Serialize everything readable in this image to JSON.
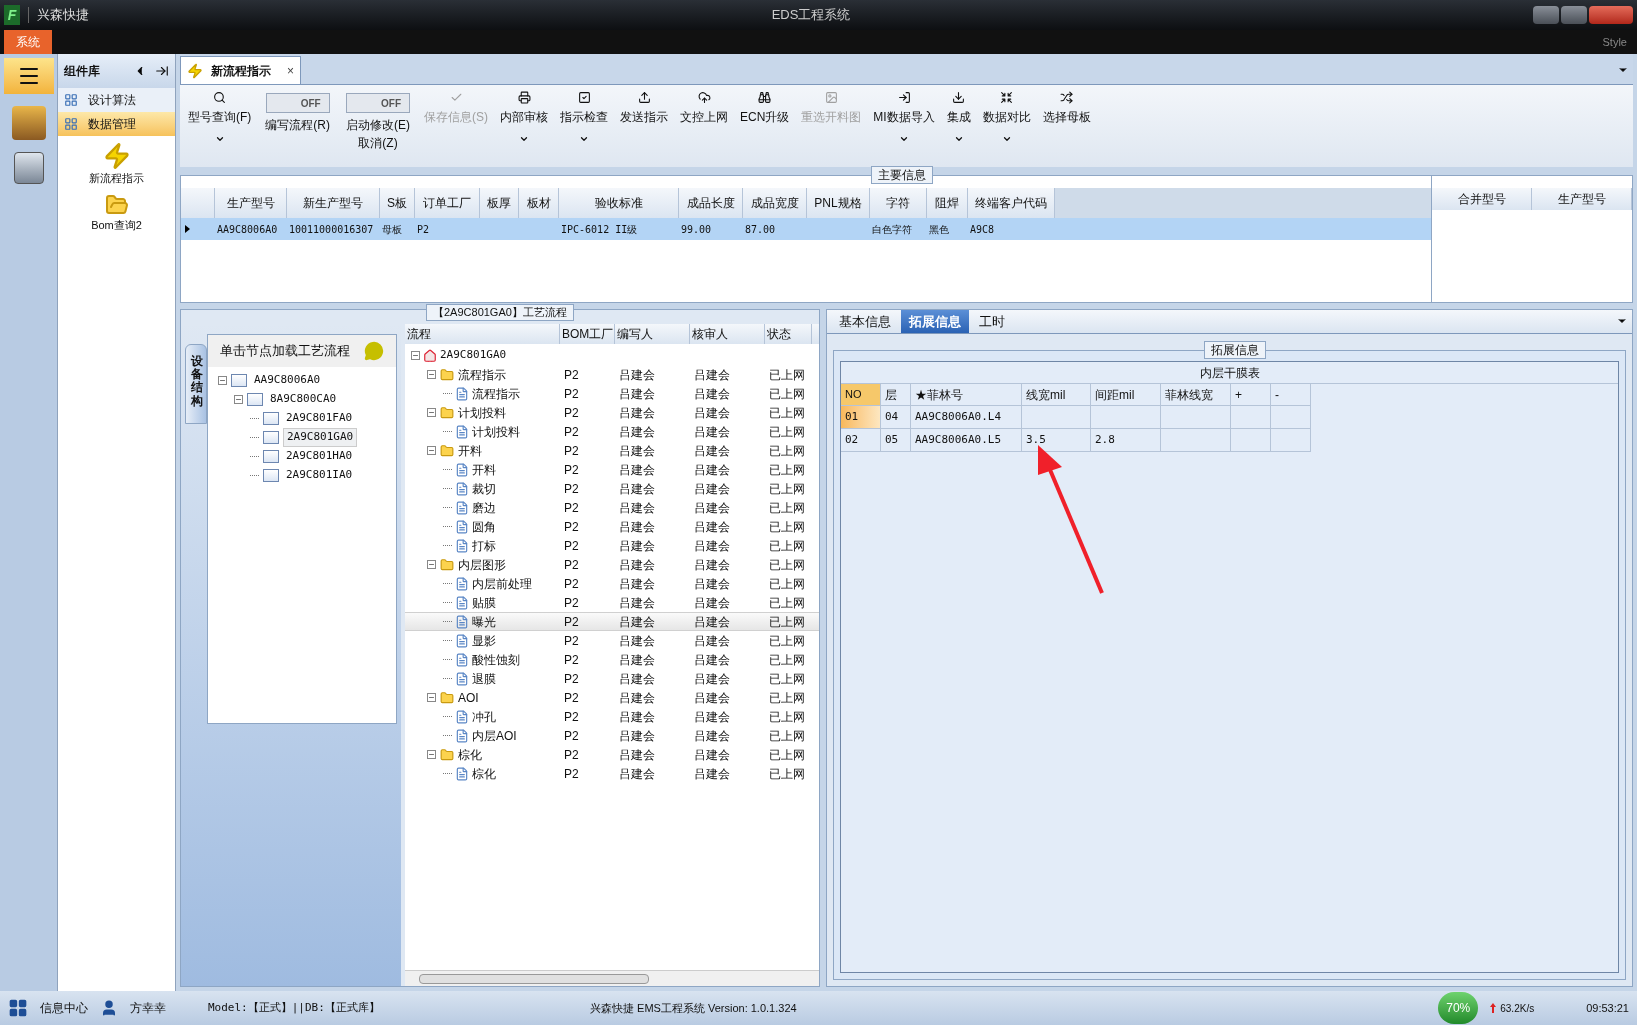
{
  "window": {
    "logo": "F",
    "app_name": "兴森快捷",
    "title": "EDS工程系统",
    "ribbon_tab": "系统",
    "style_menu": "Style"
  },
  "component_panel": {
    "title": "组件库",
    "items": [
      {
        "label": "设计算法",
        "selected": false
      },
      {
        "label": "数据管理",
        "selected": true
      }
    ],
    "tools": [
      "新流程指示",
      "Bom查询2"
    ]
  },
  "document_tab": {
    "label": "新流程指示",
    "close": "×"
  },
  "toolbar": [
    {
      "kind": "button",
      "label": "型号查询(F)",
      "disabled": false,
      "dropdown": true
    },
    {
      "kind": "toggle",
      "label": "编写流程(R)",
      "state": "OFF",
      "on": false
    },
    {
      "kind": "toggle",
      "label": "启动修改(E)",
      "state": "OFF",
      "on": false,
      "sublabel": "取消(Z)"
    },
    {
      "kind": "button",
      "label": "保存信息(S)",
      "disabled": true,
      "dropdown": false
    },
    {
      "kind": "button",
      "label": "内部审核",
      "disabled": false,
      "dropdown": true
    },
    {
      "kind": "button",
      "label": "指示检查",
      "disabled": false,
      "dropdown": true
    },
    {
      "kind": "button",
      "label": "发送指示",
      "disabled": false,
      "dropdown": false
    },
    {
      "kind": "button",
      "label": "文控上网",
      "disabled": false,
      "dropdown": false
    },
    {
      "kind": "button",
      "label": "ECN升级",
      "disabled": false,
      "dropdown": false
    },
    {
      "kind": "button",
      "label": "重选开料图",
      "disabled": true,
      "dropdown": false
    },
    {
      "kind": "button",
      "label": "MI数据导入",
      "disabled": false,
      "dropdown": true
    },
    {
      "kind": "button",
      "label": "集成",
      "disabled": false,
      "dropdown": true
    },
    {
      "kind": "button",
      "label": "数据对比",
      "disabled": false,
      "dropdown": true
    },
    {
      "kind": "button",
      "label": "选择母板",
      "disabled": false,
      "dropdown": false
    }
  ],
  "main_info": {
    "title": "主要信息",
    "columns": [
      "生产型号",
      "新生产型号",
      "S板",
      "订单工厂",
      "板厚",
      "板材",
      "验收标准",
      "成品长度",
      "成品宽度",
      "PNL规格",
      "字符",
      "阻焊",
      "终端客户代码"
    ],
    "rows": [
      {
        "selected": true,
        "cells": [
          "AA9C8006A0",
          "10011000016307",
          "母板",
          "P2",
          "",
          "",
          "IPC-6012 II级",
          "99.00",
          "87.00",
          "",
          "白色字符",
          "黑色",
          "A9C8"
        ]
      }
    ],
    "side_columns": [
      "合并型号",
      "生产型号"
    ]
  },
  "structure_panel": {
    "side_tab": "设备结构",
    "header": "单击节点加载工艺流程",
    "tree": [
      {
        "label": "AA9C8006A0",
        "expanded": true,
        "selected": false,
        "children": [
          {
            "label": "8A9C800CA0",
            "expanded": true,
            "selected": false,
            "children": [
              {
                "label": "2A9C801FA0",
                "selected": false
              },
              {
                "label": "2A9C801GA0",
                "selected": true
              },
              {
                "label": "2A9C801HA0",
                "selected": false
              },
              {
                "label": "2A9C801IA0",
                "selected": false
              }
            ]
          }
        ]
      }
    ]
  },
  "process_panel": {
    "title": "【2A9C801GA0】工艺流程",
    "columns": [
      "流程",
      "BOM工厂",
      "编写人",
      "核审人",
      "状态"
    ],
    "tree": [
      {
        "kind": "root",
        "label": "2A9C801GA0",
        "expanded": true,
        "selected": false,
        "children": [
          {
            "kind": "folder",
            "label": "流程指示",
            "expanded": true,
            "selected": false,
            "cells": [
              "P2",
              "吕建会",
              "吕建会",
              "已上网"
            ],
            "children": [
              {
                "kind": "doc",
                "label": "流程指示",
                "selected": false,
                "cells": [
                  "P2",
                  "吕建会",
                  "吕建会",
                  "已上网"
                ]
              }
            ]
          },
          {
            "kind": "folder",
            "label": "计划投料",
            "expanded": true,
            "selected": false,
            "cells": [
              "P2",
              "吕建会",
              "吕建会",
              "已上网"
            ],
            "children": [
              {
                "kind": "doc",
                "label": "计划投料",
                "selected": false,
                "cells": [
                  "P2",
                  "吕建会",
                  "吕建会",
                  "已上网"
                ]
              }
            ]
          },
          {
            "kind": "folder",
            "label": "开料",
            "expanded": true,
            "selected": false,
            "cells": [
              "P2",
              "吕建会",
              "吕建会",
              "已上网"
            ],
            "children": [
              {
                "kind": "doc",
                "label": "开料",
                "selected": false,
                "cells": [
                  "P2",
                  "吕建会",
                  "吕建会",
                  "已上网"
                ]
              },
              {
                "kind": "doc",
                "label": "裁切",
                "selected": false,
                "cells": [
                  "P2",
                  "吕建会",
                  "吕建会",
                  "已上网"
                ]
              },
              {
                "kind": "doc",
                "label": "磨边",
                "selected": false,
                "cells": [
                  "P2",
                  "吕建会",
                  "吕建会",
                  "已上网"
                ]
              },
              {
                "kind": "doc",
                "label": "圆角",
                "selected": false,
                "cells": [
                  "P2",
                  "吕建会",
                  "吕建会",
                  "已上网"
                ]
              },
              {
                "kind": "doc",
                "label": "打标",
                "selected": false,
                "cells": [
                  "P2",
                  "吕建会",
                  "吕建会",
                  "已上网"
                ]
              }
            ]
          },
          {
            "kind": "folder",
            "label": "内层图形",
            "expanded": true,
            "selected": false,
            "cells": [
              "P2",
              "吕建会",
              "吕建会",
              "已上网"
            ],
            "children": [
              {
                "kind": "doc",
                "label": "内层前处理",
                "selected": false,
                "cells": [
                  "P2",
                  "吕建会",
                  "吕建会",
                  "已上网"
                ]
              },
              {
                "kind": "doc",
                "label": "贴膜",
                "selected": false,
                "cells": [
                  "P2",
                  "吕建会",
                  "吕建会",
                  "已上网"
                ]
              },
              {
                "kind": "doc",
                "label": "曝光",
                "selected": true,
                "cells": [
                  "P2",
                  "吕建会",
                  "吕建会",
                  "已上网"
                ]
              },
              {
                "kind": "doc",
                "label": "显影",
                "selected": false,
                "cells": [
                  "P2",
                  "吕建会",
                  "吕建会",
                  "已上网"
                ]
              },
              {
                "kind": "doc",
                "label": "酸性蚀刻",
                "selected": false,
                "cells": [
                  "P2",
                  "吕建会",
                  "吕建会",
                  "已上网"
                ]
              },
              {
                "kind": "doc",
                "label": "退膜",
                "selected": false,
                "cells": [
                  "P2",
                  "吕建会",
                  "吕建会",
                  "已上网"
                ]
              }
            ]
          },
          {
            "kind": "folder",
            "label": "AOI",
            "expanded": true,
            "selected": false,
            "cells": [
              "P2",
              "吕建会",
              "吕建会",
              "已上网"
            ],
            "children": [
              {
                "kind": "doc",
                "label": "冲孔",
                "selected": false,
                "cells": [
                  "P2",
                  "吕建会",
                  "吕建会",
                  "已上网"
                ]
              },
              {
                "kind": "doc",
                "label": "内层AOI",
                "selected": false,
                "cells": [
                  "P2",
                  "吕建会",
                  "吕建会",
                  "已上网"
                ]
              }
            ]
          },
          {
            "kind": "folder",
            "label": "棕化",
            "expanded": true,
            "selected": false,
            "cells": [
              "P2",
              "吕建会",
              "吕建会",
              "已上网"
            ],
            "children": [
              {
                "kind": "doc",
                "label": "棕化",
                "selected": false,
                "cells": [
                  "P2",
                  "吕建会",
                  "吕建会",
                  "已上网"
                ]
              }
            ]
          }
        ]
      }
    ]
  },
  "detail_panel": {
    "tabs": [
      {
        "label": "基本信息",
        "selected": false
      },
      {
        "label": "拓展信息",
        "selected": true
      },
      {
        "label": "工时",
        "selected": false
      }
    ],
    "group_title": "拓展信息",
    "table_title": "内层干膜表",
    "columns": [
      "NO",
      "层",
      "★菲林号",
      "线宽mil",
      "间距mil",
      "菲林线宽",
      "+",
      "-"
    ],
    "rows": [
      {
        "selected": true,
        "cells": [
          "01",
          "04",
          "AA9C8006A0.L4",
          "",
          "",
          "",
          "",
          ""
        ]
      },
      {
        "selected": false,
        "cells": [
          "02",
          "05",
          "AA9C8006A0.L5",
          "3.5",
          "2.8",
          "",
          "",
          ""
        ]
      }
    ]
  },
  "status_bar": {
    "info_center": "信息中心",
    "user": "方幸幸",
    "model": "Model:【正式】||DB:【正式库】",
    "version": "兴森快捷 EMS工程系统 Version: 1.0.1.324",
    "gauge": "70%",
    "upload_speed": "63.2K/s",
    "time": "09:53:21"
  }
}
